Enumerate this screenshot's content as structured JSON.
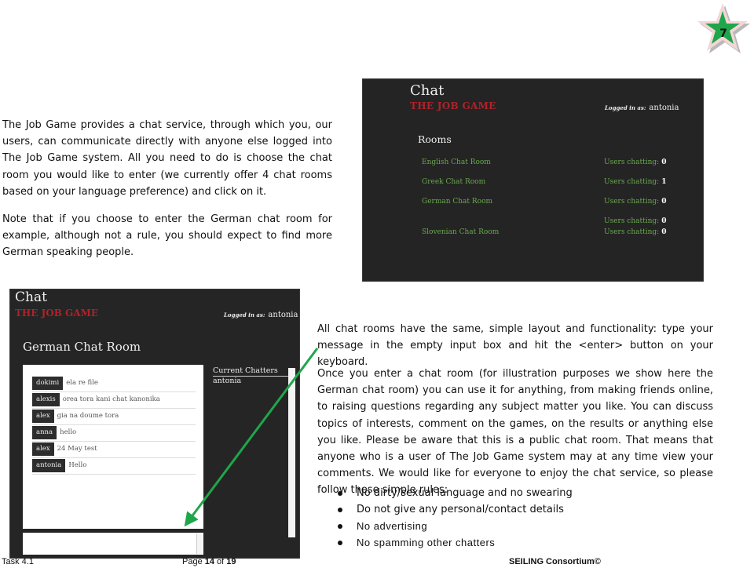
{
  "page_badge": {
    "number": "7",
    "fill": "#1fa64a"
  },
  "intro": {
    "paragraph1": "The Job Game provides a chat service, through which you, our users, can communicate directly with anyone else logged into The Job Game system. All you need to do is choose the chat room you would like to enter (we currently offer 4 chat rooms based on your language preference) and click on it.",
    "paragraph2": "Note that if you choose to enter the German chat room for example, although not a rule, you should expect to find more German speaking people."
  },
  "rooms_screen": {
    "title": "Chat",
    "brand": "THE JOB GAME",
    "logged_in_label": "Logged in as:",
    "logged_in_user": "antonia",
    "heading": "Rooms",
    "rooms": [
      {
        "name": "English Chat Room",
        "users_label": "Users chatting:",
        "count": "0"
      },
      {
        "name": "Greek Chat Room",
        "users_label": "Users chatting:",
        "count": "1"
      },
      {
        "name": "German Chat Room",
        "users_label": "Users chatting:",
        "count": "0"
      },
      {
        "name": "",
        "users_label": "Users chatting:",
        "count": "0"
      },
      {
        "name": "Slovenian Chat Room",
        "users_label": "Users chatting:",
        "count": "0"
      }
    ]
  },
  "chat_screen": {
    "title": "Chat",
    "brand": "THE JOB GAME",
    "logged_in_label": "Logged in as:",
    "logged_in_user": "antonia",
    "room_title": "German Chat Room",
    "messages": [
      {
        "user": "dokimi",
        "text": "ela re file"
      },
      {
        "user": "alexis",
        "text": "orea tora kani chat kanonika"
      },
      {
        "user": "alex",
        "text": "gia na doume tora"
      },
      {
        "user": "anna",
        "text": "hello"
      },
      {
        "user": "alex",
        "text": "24 May test"
      },
      {
        "user": "antonia",
        "text": "Hello"
      }
    ],
    "input_value": "",
    "chatters_heading": "Current Chatters",
    "chatters": [
      "antonia"
    ]
  },
  "instructions": {
    "paragraph1": "All chat rooms have the same, simple layout and functionality: type your message in the empty input box and hit the <enter> button on your keyboard.",
    "paragraph2": "Once you enter a chat room (for illustration purposes we show here the German chat room) you can use it for anything, from making friends online, to raising questions regarding any subject matter you like. You can discuss topics of interests, comment on the games, on the results or anything else you like. Please be aware that this is a public chat room. That means that anyone who is a user of The Job Game system may at any time view your comments. We would like for everyone to enjoy the chat service, so please follow these simple rules:",
    "rules": [
      "No dirty/sexual language and no swearing",
      "Do not give any personal/contact details",
      "No advertising",
      "No spamming other chatters"
    ]
  },
  "footer": {
    "task": "Task 4.1",
    "page_prefix": "Page ",
    "page_current": "14",
    "page_of": " of ",
    "page_total": "19",
    "consortium": "SEILING Consortium©"
  },
  "colors": {
    "arrow": "#1fa64a",
    "brand_red": "#b0222a",
    "room_green": "#6aa84f",
    "panel_bg": "#242424"
  }
}
